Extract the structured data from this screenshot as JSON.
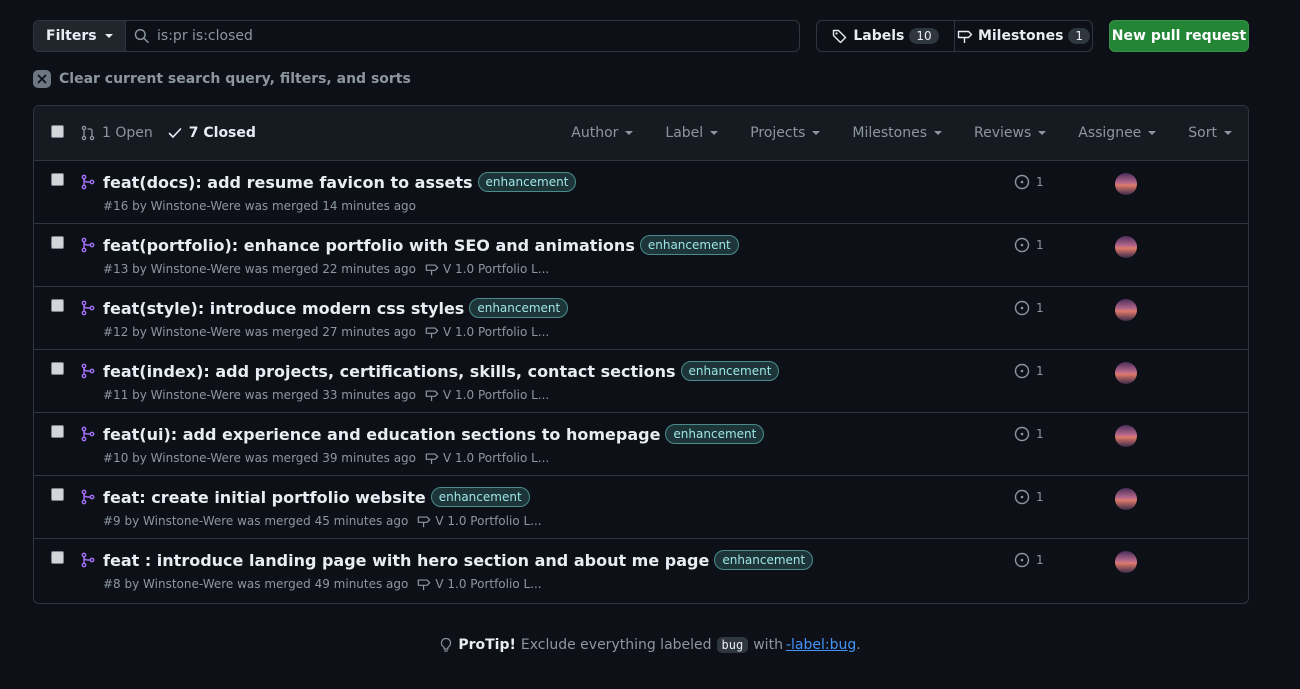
{
  "toolbar": {
    "filters_label": "Filters",
    "search_value": "is:pr is:closed",
    "labels_label": "Labels",
    "labels_count": "10",
    "milestones_label": "Milestones",
    "milestones_count": "1",
    "new_pr_label": "New pull request"
  },
  "clear_text": "Clear current search query, filters, and sorts",
  "header": {
    "open_text": "1 Open",
    "closed_text": "7 Closed",
    "filters": [
      "Author",
      "Label",
      "Projects",
      "Milestones",
      "Reviews",
      "Assignee",
      "Sort"
    ]
  },
  "rows": [
    {
      "title": "feat(docs): add resume favicon to assets",
      "label": "enhancement",
      "meta": "#16 by Winstone-Were was merged 14 minutes ago",
      "milestone": "",
      "comments": "1"
    },
    {
      "title": "feat(portfolio): enhance portfolio with SEO and animations",
      "label": "enhancement",
      "meta": "#13 by Winstone-Were was merged 22 minutes ago",
      "milestone": "V 1.0 Portfolio L...",
      "comments": "1"
    },
    {
      "title": "feat(style): introduce modern css styles",
      "label": "enhancement",
      "meta": "#12 by Winstone-Were was merged 27 minutes ago",
      "milestone": "V 1.0 Portfolio L...",
      "comments": "1"
    },
    {
      "title": "feat(index): add projects, certifications, skills, contact sections",
      "label": "enhancement",
      "meta": "#11 by Winstone-Were was merged 33 minutes ago",
      "milestone": "V 1.0 Portfolio L...",
      "comments": "1"
    },
    {
      "title": "feat(ui): add experience and education sections to homepage",
      "label": "enhancement",
      "meta": "#10 by Winstone-Were was merged 39 minutes ago",
      "milestone": "V 1.0 Portfolio L...",
      "comments": "1"
    },
    {
      "title": "feat: create initial portfolio website",
      "label": "enhancement",
      "meta": "#9 by Winstone-Were was merged 45 minutes ago",
      "milestone": "V 1.0 Portfolio L...",
      "comments": "1"
    },
    {
      "title": "feat : introduce landing page with hero section and about me page",
      "label": "enhancement",
      "meta": "#8 by Winstone-Were was merged 49 minutes ago",
      "milestone": "V 1.0 Portfolio L...",
      "comments": "1"
    }
  ],
  "protip": {
    "prefix": "ProTip!",
    "text1": "Exclude everything labeled",
    "code": "bug",
    "text2": "with",
    "link": "-label:bug",
    "suffix": "."
  },
  "icons": {
    "search": "search-icon",
    "tag": "tag-icon",
    "milestone": "milestone-icon",
    "pr": "git-pull-request-icon",
    "merged": "git-merge-icon",
    "check": "check-icon",
    "comment": "comment-icon",
    "bulb": "light-bulb-icon"
  },
  "colors": {
    "background": "#0d1117",
    "merged": "#a371f7",
    "primary_button": "#238636",
    "label": "#9ee5e5",
    "link": "#4493f8"
  }
}
